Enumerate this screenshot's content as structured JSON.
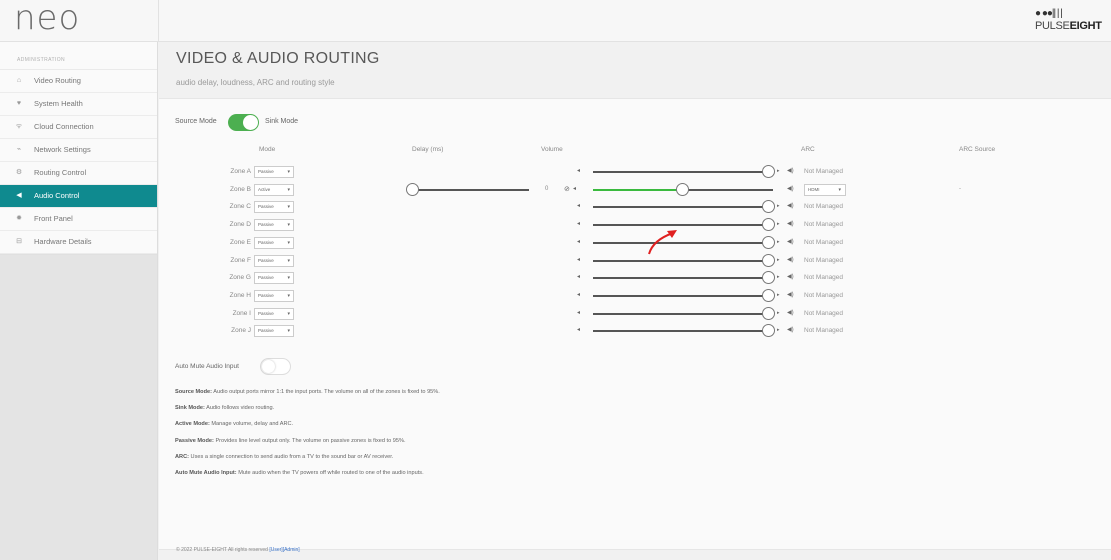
{
  "app": {
    "logo": "neo"
  },
  "brand": {
    "dots": "● ●●|| |  |",
    "text_light": "PULSE",
    "text_bold": "EIGHT"
  },
  "sidebar": {
    "heading": "ADMINISTRATION",
    "items": [
      {
        "label": "Video Routing",
        "icon": "home-icon",
        "glyph": "⌂"
      },
      {
        "label": "System Health",
        "icon": "heart-icon",
        "glyph": "♥"
      },
      {
        "label": "Cloud Connection",
        "icon": "wifi-icon",
        "glyph": "ᯤ"
      },
      {
        "label": "Network Settings",
        "icon": "network-icon",
        "glyph": "⌁"
      },
      {
        "label": "Routing Control",
        "icon": "gears-icon",
        "glyph": "⚙"
      },
      {
        "label": "Audio Control",
        "icon": "speaker-icon",
        "glyph": "◀"
      },
      {
        "label": "Front Panel",
        "icon": "sun-icon",
        "glyph": "✹"
      },
      {
        "label": "Hardware Details",
        "icon": "hdd-icon",
        "glyph": "⊟"
      }
    ],
    "active_index": 5
  },
  "page": {
    "title": "VIDEO & AUDIO ROUTING",
    "subtitle": "audio delay, loudness, ARC and routing style"
  },
  "mode_toggle": {
    "left_label": "Source Mode",
    "right_label": "Sink Mode",
    "state": "Sink Mode"
  },
  "columns": {
    "mode": "Mode",
    "delay": "Delay (ms)",
    "volume": "Volume",
    "arc": "ARC",
    "arc_source": "ARC Source"
  },
  "zones": [
    {
      "label": "Zone A",
      "mode": "Passive",
      "arc": "Not Managed"
    },
    {
      "label": "Zone B",
      "mode": "Active",
      "delay": "0",
      "volume_fraction": 0.5,
      "arc_select": "HDMI",
      "arc_source": "-"
    },
    {
      "label": "Zone C",
      "mode": "Passive",
      "arc": "Not Managed"
    },
    {
      "label": "Zone D",
      "mode": "Passive",
      "arc": "Not Managed"
    },
    {
      "label": "Zone E",
      "mode": "Passive",
      "arc": "Not Managed"
    },
    {
      "label": "Zone F",
      "mode": "Passive",
      "arc": "Not Managed"
    },
    {
      "label": "Zone G",
      "mode": "Passive",
      "arc": "Not Managed"
    },
    {
      "label": "Zone H",
      "mode": "Passive",
      "arc": "Not Managed"
    },
    {
      "label": "Zone I",
      "mode": "Passive",
      "arc": "Not Managed"
    },
    {
      "label": "Zone J",
      "mode": "Passive",
      "arc": "Not Managed"
    }
  ],
  "automute": {
    "label": "Auto Mute Audio Input",
    "state": "off"
  },
  "notes": [
    {
      "term": "Source Mode:",
      "text": "Audio output ports mirror 1:1 the input ports. The volume on all of the zones is fixed to 95%."
    },
    {
      "term": "Sink Mode:",
      "text": "Audio follows video routing."
    },
    {
      "term": "Active Mode:",
      "text": "Manage volume, delay and ARC."
    },
    {
      "term": "Passive Mode:",
      "text": "Provides line level output only. The volume on passive zones is fixed to 95%."
    },
    {
      "term": "ARC:",
      "text": "Uses a single connection to send audio from a TV to the sound bar or AV receiver."
    },
    {
      "term": "Auto Mute Audio Input:",
      "text": "Mute audio when the TV powers off while routed to one of the audio inputs."
    }
  ],
  "footer": {
    "text": "© 2022 PULSE-EIGHT All rights reserved",
    "user_link": "[User]",
    "admin_link": "[Admin]"
  },
  "colors": {
    "accent": "#0f8a8f",
    "toggle_on": "#4caf50",
    "slider_active": "#3aba3e",
    "annotation_arrow": "#e02020"
  },
  "icons": {
    "volume_down": "volume-down-icon",
    "volume_up": "volume-up-icon",
    "mute": "mute-icon"
  }
}
